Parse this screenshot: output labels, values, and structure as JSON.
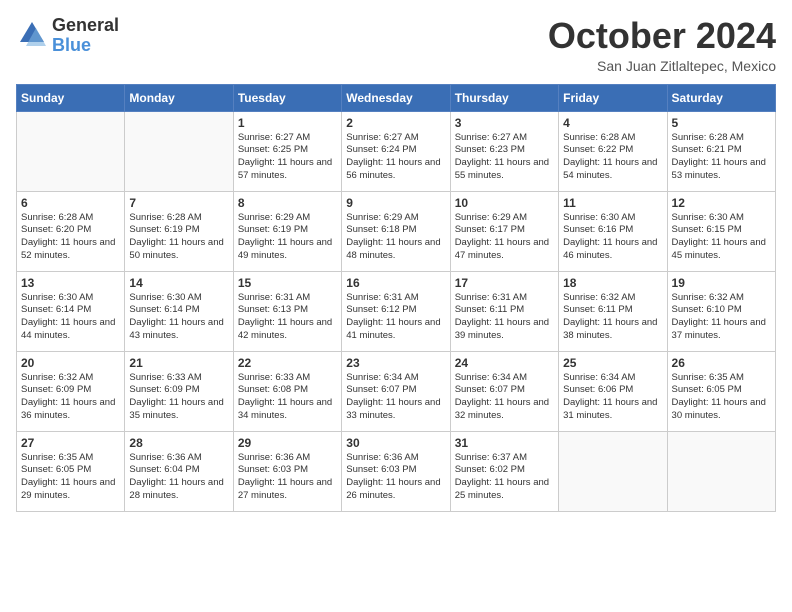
{
  "logo": {
    "text_general": "General",
    "text_blue": "Blue"
  },
  "title": "October 2024",
  "location": "San Juan Zitlaltepec, Mexico",
  "weekdays": [
    "Sunday",
    "Monday",
    "Tuesday",
    "Wednesday",
    "Thursday",
    "Friday",
    "Saturday"
  ],
  "weeks": [
    [
      {
        "day": "",
        "info": ""
      },
      {
        "day": "",
        "info": ""
      },
      {
        "day": "1",
        "info": "Sunrise: 6:27 AM\nSunset: 6:25 PM\nDaylight: 11 hours and 57 minutes."
      },
      {
        "day": "2",
        "info": "Sunrise: 6:27 AM\nSunset: 6:24 PM\nDaylight: 11 hours and 56 minutes."
      },
      {
        "day": "3",
        "info": "Sunrise: 6:27 AM\nSunset: 6:23 PM\nDaylight: 11 hours and 55 minutes."
      },
      {
        "day": "4",
        "info": "Sunrise: 6:28 AM\nSunset: 6:22 PM\nDaylight: 11 hours and 54 minutes."
      },
      {
        "day": "5",
        "info": "Sunrise: 6:28 AM\nSunset: 6:21 PM\nDaylight: 11 hours and 53 minutes."
      }
    ],
    [
      {
        "day": "6",
        "info": "Sunrise: 6:28 AM\nSunset: 6:20 PM\nDaylight: 11 hours and 52 minutes."
      },
      {
        "day": "7",
        "info": "Sunrise: 6:28 AM\nSunset: 6:19 PM\nDaylight: 11 hours and 50 minutes."
      },
      {
        "day": "8",
        "info": "Sunrise: 6:29 AM\nSunset: 6:19 PM\nDaylight: 11 hours and 49 minutes."
      },
      {
        "day": "9",
        "info": "Sunrise: 6:29 AM\nSunset: 6:18 PM\nDaylight: 11 hours and 48 minutes."
      },
      {
        "day": "10",
        "info": "Sunrise: 6:29 AM\nSunset: 6:17 PM\nDaylight: 11 hours and 47 minutes."
      },
      {
        "day": "11",
        "info": "Sunrise: 6:30 AM\nSunset: 6:16 PM\nDaylight: 11 hours and 46 minutes."
      },
      {
        "day": "12",
        "info": "Sunrise: 6:30 AM\nSunset: 6:15 PM\nDaylight: 11 hours and 45 minutes."
      }
    ],
    [
      {
        "day": "13",
        "info": "Sunrise: 6:30 AM\nSunset: 6:14 PM\nDaylight: 11 hours and 44 minutes."
      },
      {
        "day": "14",
        "info": "Sunrise: 6:30 AM\nSunset: 6:14 PM\nDaylight: 11 hours and 43 minutes."
      },
      {
        "day": "15",
        "info": "Sunrise: 6:31 AM\nSunset: 6:13 PM\nDaylight: 11 hours and 42 minutes."
      },
      {
        "day": "16",
        "info": "Sunrise: 6:31 AM\nSunset: 6:12 PM\nDaylight: 11 hours and 41 minutes."
      },
      {
        "day": "17",
        "info": "Sunrise: 6:31 AM\nSunset: 6:11 PM\nDaylight: 11 hours and 39 minutes."
      },
      {
        "day": "18",
        "info": "Sunrise: 6:32 AM\nSunset: 6:11 PM\nDaylight: 11 hours and 38 minutes."
      },
      {
        "day": "19",
        "info": "Sunrise: 6:32 AM\nSunset: 6:10 PM\nDaylight: 11 hours and 37 minutes."
      }
    ],
    [
      {
        "day": "20",
        "info": "Sunrise: 6:32 AM\nSunset: 6:09 PM\nDaylight: 11 hours and 36 minutes."
      },
      {
        "day": "21",
        "info": "Sunrise: 6:33 AM\nSunset: 6:09 PM\nDaylight: 11 hours and 35 minutes."
      },
      {
        "day": "22",
        "info": "Sunrise: 6:33 AM\nSunset: 6:08 PM\nDaylight: 11 hours and 34 minutes."
      },
      {
        "day": "23",
        "info": "Sunrise: 6:34 AM\nSunset: 6:07 PM\nDaylight: 11 hours and 33 minutes."
      },
      {
        "day": "24",
        "info": "Sunrise: 6:34 AM\nSunset: 6:07 PM\nDaylight: 11 hours and 32 minutes."
      },
      {
        "day": "25",
        "info": "Sunrise: 6:34 AM\nSunset: 6:06 PM\nDaylight: 11 hours and 31 minutes."
      },
      {
        "day": "26",
        "info": "Sunrise: 6:35 AM\nSunset: 6:05 PM\nDaylight: 11 hours and 30 minutes."
      }
    ],
    [
      {
        "day": "27",
        "info": "Sunrise: 6:35 AM\nSunset: 6:05 PM\nDaylight: 11 hours and 29 minutes."
      },
      {
        "day": "28",
        "info": "Sunrise: 6:36 AM\nSunset: 6:04 PM\nDaylight: 11 hours and 28 minutes."
      },
      {
        "day": "29",
        "info": "Sunrise: 6:36 AM\nSunset: 6:03 PM\nDaylight: 11 hours and 27 minutes."
      },
      {
        "day": "30",
        "info": "Sunrise: 6:36 AM\nSunset: 6:03 PM\nDaylight: 11 hours and 26 minutes."
      },
      {
        "day": "31",
        "info": "Sunrise: 6:37 AM\nSunset: 6:02 PM\nDaylight: 11 hours and 25 minutes."
      },
      {
        "day": "",
        "info": ""
      },
      {
        "day": "",
        "info": ""
      }
    ]
  ]
}
